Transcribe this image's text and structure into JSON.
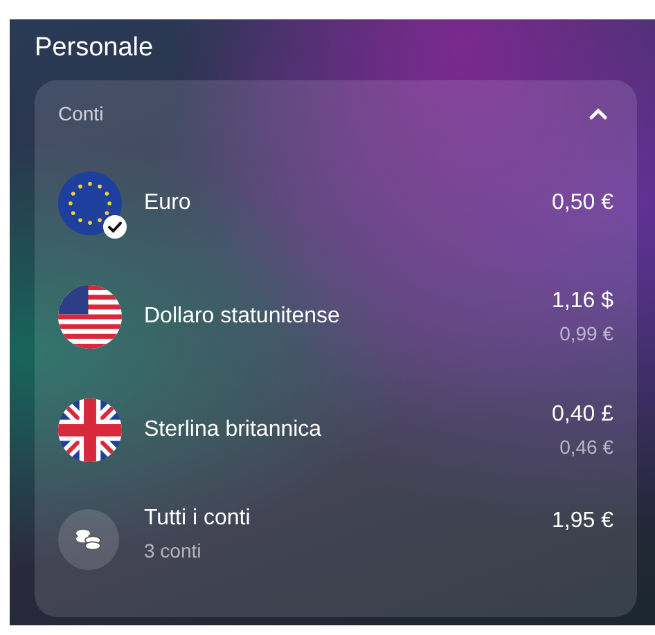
{
  "title": "Personale",
  "accounts_card": {
    "label": "Conti",
    "expanded": true,
    "rows": [
      {
        "kind": "eu",
        "name": "Euro",
        "amount": "0,50 €",
        "primary": true
      },
      {
        "kind": "us",
        "name": "Dollaro statunitense",
        "amount": "1,16 $",
        "converted": "0,99 €",
        "primary": false
      },
      {
        "kind": "gb",
        "name": "Sterlina britannica",
        "amount": "0,40 £",
        "converted": "0,46 €",
        "primary": false
      },
      {
        "kind": "all",
        "name": "Tutti i conti",
        "subtitle": "3 conti",
        "amount": "1,95 €",
        "primary": false
      }
    ]
  }
}
